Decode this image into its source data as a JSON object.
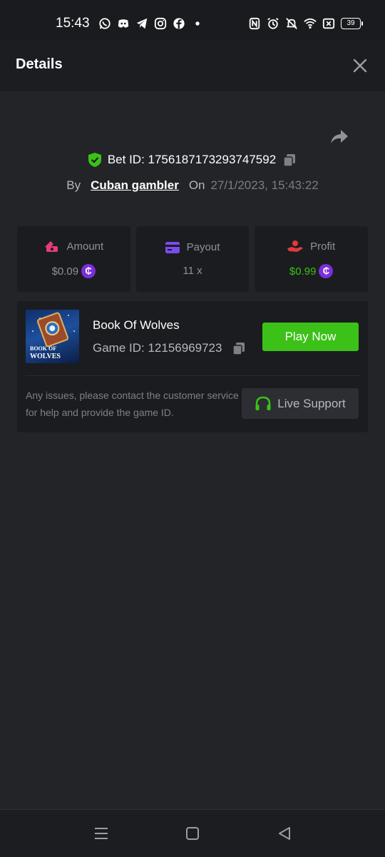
{
  "status_bar": {
    "time": "15:43",
    "app_icons": [
      "whatsapp-icon",
      "discord-icon",
      "telegram-icon",
      "instagram-icon",
      "facebook-icon"
    ],
    "battery": "39"
  },
  "header": {
    "title": "Details"
  },
  "bet": {
    "id_text": "Bet ID: 1756187173293747592",
    "by_label": "By",
    "user": "Cuban gambler",
    "on_label": "On",
    "date": "27/1/2023, 15:43:22"
  },
  "stats": {
    "amount": {
      "label": "Amount",
      "value": "$0.09"
    },
    "payout": {
      "label": "Payout",
      "value": "11 x"
    },
    "profit": {
      "label": "Profit",
      "value": "$0.99"
    }
  },
  "game": {
    "name": "Book Of Wolves",
    "id_text": "Game ID: 12156969723",
    "thumb_text_line1": "BOOK OF",
    "thumb_text_line2": "WOLVES",
    "play_label": "Play Now",
    "issue_text": "Any issues, please contact the customer service for help and provide the game ID.",
    "support_label": "Live Support"
  },
  "colors": {
    "accent_green": "#3bc117",
    "coin_purple": "#7b2fd8",
    "amount_pink": "#e23c7c",
    "payout_purple": "#7a4cf0",
    "profit_red": "#e0393e"
  }
}
